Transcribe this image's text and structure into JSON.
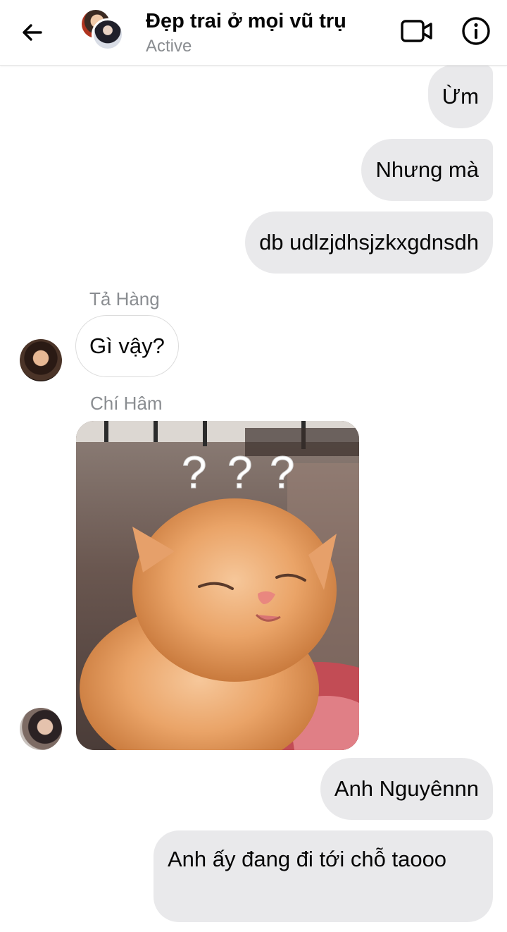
{
  "header": {
    "title": "Đẹp trai ở mọi vũ trụ",
    "status": "Active",
    "back_icon": "arrow-left-icon",
    "video_icon": "video-camera-icon",
    "info_icon": "info-icon"
  },
  "messages": [
    {
      "direction": "outgoing",
      "text": "Ừm"
    },
    {
      "direction": "outgoing",
      "text": "Nhưng mà"
    },
    {
      "direction": "outgoing",
      "text": "db udlzjdhsjzkxgdnsdh"
    },
    {
      "direction": "incoming",
      "sender": "Tả Hàng",
      "text": "Gì vậy?"
    },
    {
      "direction": "incoming",
      "sender": "Chí Hâm",
      "image_caption": "???"
    },
    {
      "direction": "outgoing",
      "text": "Anh Nguyênnn"
    },
    {
      "direction": "outgoing",
      "text": "Anh ấy đang đi tới chỗ taooo"
    }
  ],
  "colors": {
    "outgoing_bubble": "#e9e9eb",
    "incoming_bubble": "#ffffff",
    "secondary_text": "#8a8d91",
    "primary_text": "#050505"
  }
}
